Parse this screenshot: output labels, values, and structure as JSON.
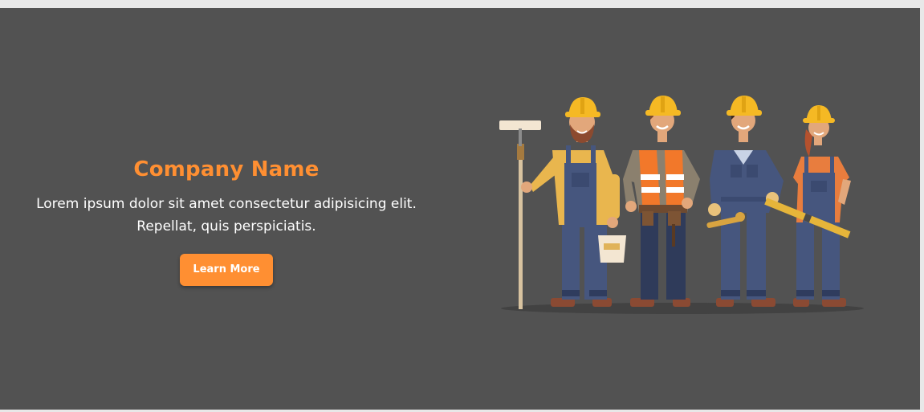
{
  "hero": {
    "title": "Company Name",
    "description_line1": "Lorem ipsum dolor sit amet consectetur adipisicing elit.",
    "description_line2": "Repellat, quis perspiciatis.",
    "button_label": "Learn More"
  },
  "illustration": {
    "subject": "four construction workers with hard hats and tools",
    "icon_names": [
      "painter-worker-icon",
      "safety-vest-worker-icon",
      "plumber-worker-icon",
      "level-worker-icon"
    ]
  },
  "colors": {
    "background": "#525252",
    "accent": "#ff8f32",
    "text": "#ffffff",
    "page": "#e8e8e8"
  }
}
